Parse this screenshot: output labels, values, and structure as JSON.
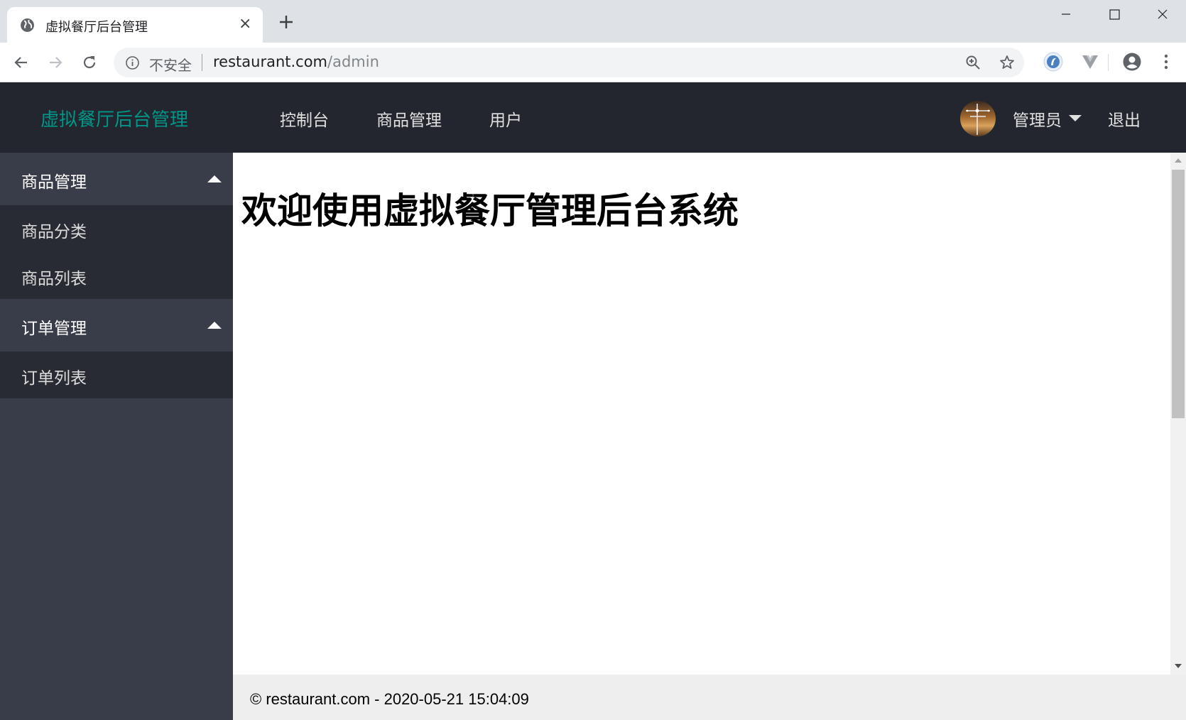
{
  "browser": {
    "tab": {
      "title": "虚拟餐厅后台管理",
      "close": "×"
    },
    "omnibox": {
      "security_label": "不安全",
      "url_host": "restaurant.com",
      "url_path": "/admin"
    }
  },
  "header": {
    "brand": "虚拟餐厅后台管理",
    "nav": [
      "控制台",
      "商品管理",
      "用户"
    ],
    "user_name": "管理员",
    "logout": "退出"
  },
  "sidebar": {
    "groups": [
      {
        "label": "商品管理",
        "expanded": true,
        "items": [
          "商品分类",
          "商品列表"
        ]
      },
      {
        "label": "订单管理",
        "expanded": true,
        "items": [
          "订单列表"
        ]
      }
    ]
  },
  "main": {
    "heading": "欢迎使用虚拟餐厅管理后台系统"
  },
  "footer": {
    "text": "© restaurant.com - 2020-05-21 15:04:09"
  },
  "colors": {
    "header_bg": "#23262e",
    "brand": "#009688",
    "sidebar_bg": "#393d49",
    "sidebar_sub_bg": "#282b33",
    "footer_bg": "#eeeeee"
  }
}
